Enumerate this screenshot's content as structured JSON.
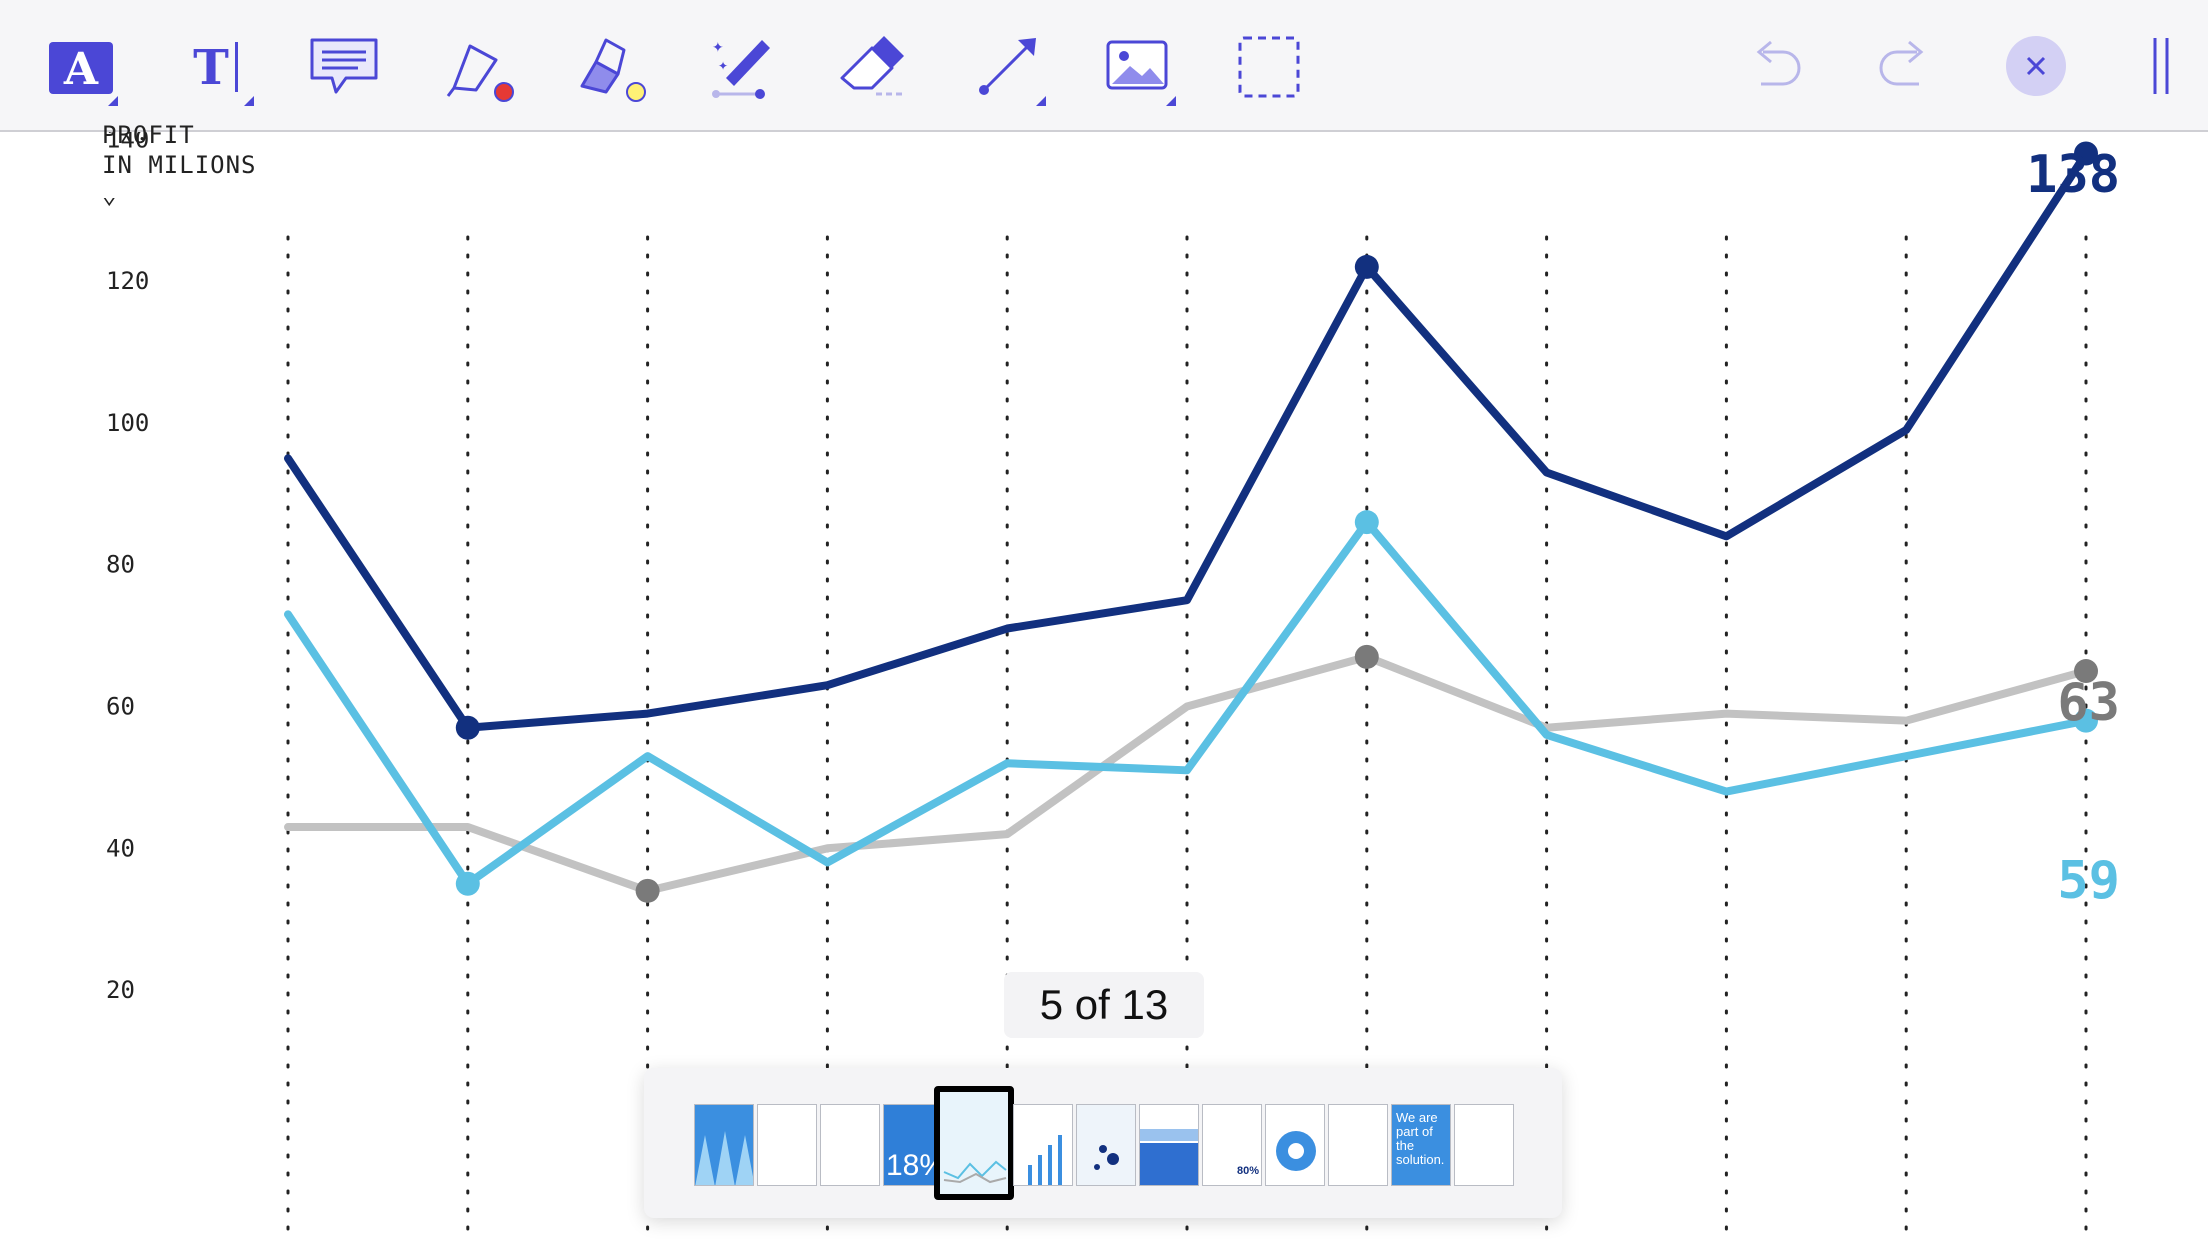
{
  "toolbar": {
    "tools": [
      {
        "name": "text-style-tool",
        "icon": "text-style-icon",
        "glyph": "A"
      },
      {
        "name": "text-tool",
        "icon": "text-insert-icon",
        "glyph": "T"
      },
      {
        "name": "comment-tool",
        "icon": "comment-icon"
      },
      {
        "name": "pen-tool",
        "icon": "pen-icon",
        "dot_color": "#e53935"
      },
      {
        "name": "highlighter-tool",
        "icon": "highlighter-icon",
        "dot_color": "#fff176"
      },
      {
        "name": "magic-pen-tool",
        "icon": "magic-pen-icon"
      },
      {
        "name": "eraser-tool",
        "icon": "eraser-icon"
      },
      {
        "name": "line-tool",
        "icon": "line-arrow-icon"
      },
      {
        "name": "image-tool",
        "icon": "image-icon"
      },
      {
        "name": "selection-tool",
        "icon": "lasso-select-icon"
      }
    ],
    "accent": "#4b47d6",
    "disabled": "#b8b6ea"
  },
  "chart_data": {
    "type": "line",
    "ylabel": "PROFIT\nIN MILIONS\n⌄",
    "ylim": [
      0,
      140
    ],
    "yticks": [
      20,
      40,
      60,
      80,
      100,
      120,
      140
    ],
    "x": [
      1,
      2,
      3,
      4,
      5,
      6,
      7,
      8,
      9,
      10,
      11
    ],
    "grid": "vertical-dotted",
    "series": [
      {
        "values": [
          95,
          57,
          59,
          63,
          71,
          75,
          122,
          93,
          84,
          99,
          138
        ],
        "color": "#12307f",
        "markers": [
          1,
          6,
          10
        ],
        "end_label": "138"
      },
      {
        "values": [
          73,
          35,
          53,
          38,
          52,
          51,
          86,
          56,
          48,
          53,
          58
        ],
        "color": "#5bc0e3",
        "markers": [
          1,
          6,
          10
        ],
        "end_label": "59"
      },
      {
        "values": [
          43,
          43,
          34,
          40,
          42,
          60,
          67,
          57,
          59,
          58,
          65
        ],
        "color": "#c2c2c2",
        "markers": [
          2,
          6,
          10
        ],
        "end_label": "63",
        "marker_color": "#7a7a7a",
        "label_color": "#7a7a7a"
      }
    ]
  },
  "page_indicator": {
    "text": "5 of 13"
  },
  "thumbnails": {
    "count": 13,
    "selected_index": 4,
    "texts": {
      "3": "18%",
      "8": "80%",
      "11": "We are part of the solution."
    }
  }
}
